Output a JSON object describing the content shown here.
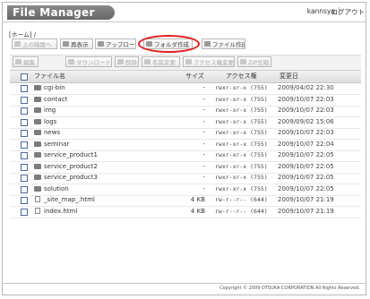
{
  "app": {
    "title": "File Manager"
  },
  "header": {
    "user": "kannsya",
    "separator": "|",
    "logout_label": "ログアウト"
  },
  "breadcrumb": {
    "text": "[ホーム] /"
  },
  "toolbar": {
    "up_label": "上の階層へ",
    "refresh_label": "再表示",
    "upload_label": "アップロー",
    "new_folder_label": "フォルダ作成",
    "new_file_label": "ファイル作成"
  },
  "actions": {
    "edit_label": "編集",
    "download_label": "ダウンロード",
    "delete_label": "削除",
    "rename_label": "名前変更",
    "permission_label": "アクセス権変更",
    "zip_label": "ZIP圧縮"
  },
  "table": {
    "columns": {
      "name": "ファイル名",
      "size": "サイズ",
      "access": "アクセス権",
      "date": "変更日"
    },
    "rows": [
      {
        "name": "cgi-bin",
        "type": "folder",
        "size": "-",
        "access": "rwxr-xr-x  (755)",
        "date": "2009/04/02 22:30"
      },
      {
        "name": "contact",
        "type": "folder",
        "size": "-",
        "access": "rwxr-xr-x  (755)",
        "date": "2009/10/07 22:03"
      },
      {
        "name": "img",
        "type": "folder",
        "size": "-",
        "access": "rwxr-xr-x  (755)",
        "date": "2009/10/07 22:03"
      },
      {
        "name": "logs",
        "type": "folder",
        "size": "-",
        "access": "rwxr-xr-x  (755)",
        "date": "2009/09/02 15:06"
      },
      {
        "name": "news",
        "type": "folder",
        "size": "-",
        "access": "rwxr-xr-x  (755)",
        "date": "2009/10/07 22:03"
      },
      {
        "name": "seminar",
        "type": "folder",
        "size": "-",
        "access": "rwxr-xr-x  (755)",
        "date": "2009/10/07 22:04"
      },
      {
        "name": "service_product1",
        "type": "folder",
        "size": "-",
        "access": "rwxr-xr-x  (755)",
        "date": "2009/10/07 22:05"
      },
      {
        "name": "service_product2",
        "type": "folder",
        "size": "-",
        "access": "rwxr-xr-x  (755)",
        "date": "2009/10/07 22:05"
      },
      {
        "name": "service_product3",
        "type": "folder",
        "size": "-",
        "access": "rwxr-xr-x  (755)",
        "date": "2009/10/07 22:05"
      },
      {
        "name": "solution",
        "type": "folder",
        "size": "-",
        "access": "rwxr-xr-x  (755)",
        "date": "2009/10/07 22:05"
      },
      {
        "name": "_site_map_.html",
        "type": "file",
        "size": "4 KB",
        "access": "rw-r--r--  (644)",
        "date": "2009/10/07 21:19"
      },
      {
        "name": "index.html",
        "type": "file",
        "size": "4 KB",
        "access": "rw-r--r--  (644)",
        "date": "2009/10/07 21:19"
      }
    ]
  },
  "footer": {
    "copyright": "Copyright © 2009 OTSUKA CORPORATION All Rights Reserved."
  },
  "colors": {
    "highlight": "#e11e1e",
    "logo_bg": "#777777",
    "checkbox_border": "#4a6a9a"
  },
  "icons": {
    "folder": "folder-icon",
    "file": "file-icon"
  }
}
